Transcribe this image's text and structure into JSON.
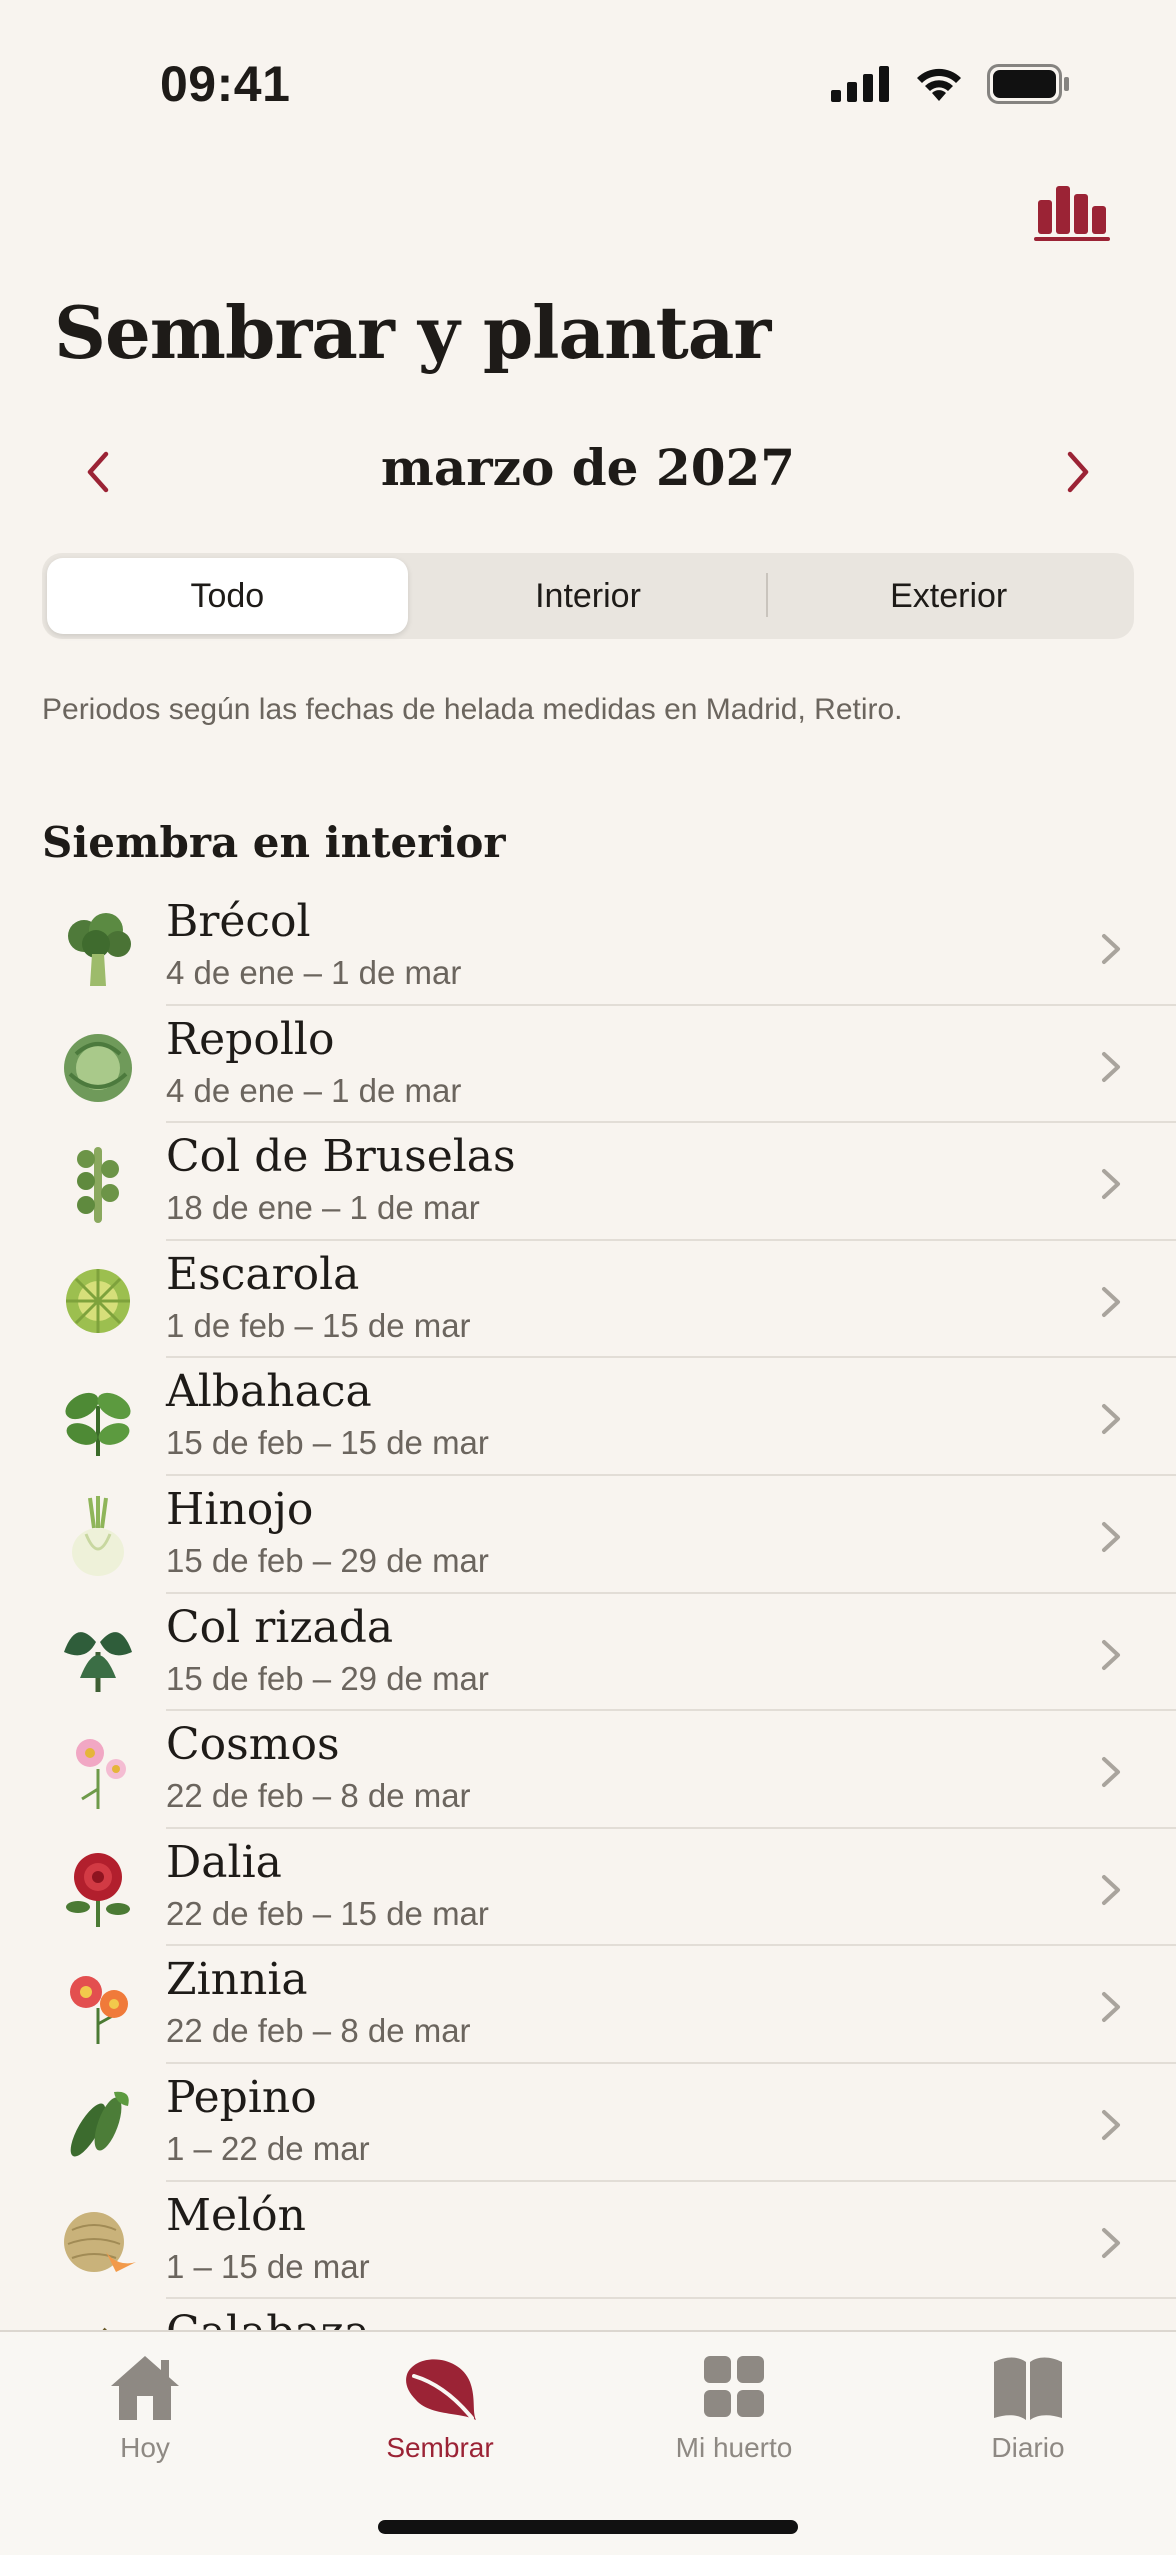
{
  "status_bar": {
    "time": "09:41"
  },
  "header": {
    "title": "Sembrar y plantar",
    "chart_icon": "bar-chart-icon"
  },
  "month_nav": {
    "label": "marzo de 2027"
  },
  "segments": {
    "all": "Todo",
    "indoor": "Interior",
    "outdoor": "Exterior",
    "selected": "Todo"
  },
  "frost_note": "Periodos según las fechas de helada medidas en Madrid, Retiro.",
  "section": {
    "title": "Siembra en interior"
  },
  "plants": [
    {
      "name": "Brécol",
      "range": "4 de ene – 1 de mar",
      "icon": "broccoli-icon"
    },
    {
      "name": "Repollo",
      "range": "4 de ene – 1 de mar",
      "icon": "cabbage-icon"
    },
    {
      "name": "Col de Bruselas",
      "range": "18 de ene – 1 de mar",
      "icon": "brussels-sprouts-icon"
    },
    {
      "name": "Escarola",
      "range": "1 de feb – 15 de mar",
      "icon": "endive-icon"
    },
    {
      "name": "Albahaca",
      "range": "15 de feb – 15 de mar",
      "icon": "basil-icon"
    },
    {
      "name": "Hinojo",
      "range": "15 de feb – 29 de mar",
      "icon": "fennel-icon"
    },
    {
      "name": "Col rizada",
      "range": "15 de feb – 29 de mar",
      "icon": "kale-icon"
    },
    {
      "name": "Cosmos",
      "range": "22 de feb – 8 de mar",
      "icon": "cosmos-flower-icon"
    },
    {
      "name": "Dalia",
      "range": "22 de feb – 15 de mar",
      "icon": "dahlia-icon"
    },
    {
      "name": "Zinnia",
      "range": "22 de feb – 8 de mar",
      "icon": "zinnia-icon"
    },
    {
      "name": "Pepino",
      "range": "1 – 22 de mar",
      "icon": "cucumber-icon"
    },
    {
      "name": "Melón",
      "range": "1 – 15 de mar",
      "icon": "melon-icon"
    },
    {
      "name": "Calabaza",
      "range": "",
      "icon": "squash-icon"
    }
  ],
  "tabs": [
    {
      "label": "Hoy",
      "icon": "house-icon",
      "active": false
    },
    {
      "label": "Sembrar",
      "icon": "leaf-icon",
      "active": true
    },
    {
      "label": "Mi huerto",
      "icon": "grid-icon",
      "active": false
    },
    {
      "label": "Diario",
      "icon": "book-icon",
      "active": false
    }
  ],
  "colors": {
    "accent": "#9b2335",
    "background": "#f8f4ef",
    "secondary_text": "#6b655e",
    "tab_inactive": "#8e8983"
  }
}
